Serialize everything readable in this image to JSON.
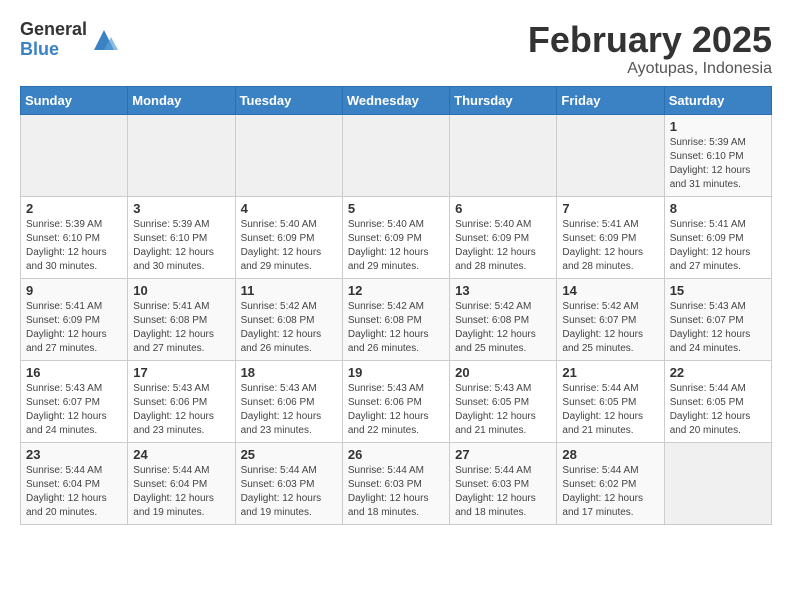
{
  "header": {
    "logo_general": "General",
    "logo_blue": "Blue",
    "month": "February 2025",
    "location": "Ayotupas, Indonesia"
  },
  "calendar": {
    "days_of_week": [
      "Sunday",
      "Monday",
      "Tuesday",
      "Wednesday",
      "Thursday",
      "Friday",
      "Saturday"
    ],
    "weeks": [
      [
        {
          "day": "",
          "info": ""
        },
        {
          "day": "",
          "info": ""
        },
        {
          "day": "",
          "info": ""
        },
        {
          "day": "",
          "info": ""
        },
        {
          "day": "",
          "info": ""
        },
        {
          "day": "",
          "info": ""
        },
        {
          "day": "1",
          "info": "Sunrise: 5:39 AM\nSunset: 6:10 PM\nDaylight: 12 hours\nand 31 minutes."
        }
      ],
      [
        {
          "day": "2",
          "info": "Sunrise: 5:39 AM\nSunset: 6:10 PM\nDaylight: 12 hours\nand 30 minutes."
        },
        {
          "day": "3",
          "info": "Sunrise: 5:39 AM\nSunset: 6:10 PM\nDaylight: 12 hours\nand 30 minutes."
        },
        {
          "day": "4",
          "info": "Sunrise: 5:40 AM\nSunset: 6:09 PM\nDaylight: 12 hours\nand 29 minutes."
        },
        {
          "day": "5",
          "info": "Sunrise: 5:40 AM\nSunset: 6:09 PM\nDaylight: 12 hours\nand 29 minutes."
        },
        {
          "day": "6",
          "info": "Sunrise: 5:40 AM\nSunset: 6:09 PM\nDaylight: 12 hours\nand 28 minutes."
        },
        {
          "day": "7",
          "info": "Sunrise: 5:41 AM\nSunset: 6:09 PM\nDaylight: 12 hours\nand 28 minutes."
        },
        {
          "day": "8",
          "info": "Sunrise: 5:41 AM\nSunset: 6:09 PM\nDaylight: 12 hours\nand 27 minutes."
        }
      ],
      [
        {
          "day": "9",
          "info": "Sunrise: 5:41 AM\nSunset: 6:09 PM\nDaylight: 12 hours\nand 27 minutes."
        },
        {
          "day": "10",
          "info": "Sunrise: 5:41 AM\nSunset: 6:08 PM\nDaylight: 12 hours\nand 27 minutes."
        },
        {
          "day": "11",
          "info": "Sunrise: 5:42 AM\nSunset: 6:08 PM\nDaylight: 12 hours\nand 26 minutes."
        },
        {
          "day": "12",
          "info": "Sunrise: 5:42 AM\nSunset: 6:08 PM\nDaylight: 12 hours\nand 26 minutes."
        },
        {
          "day": "13",
          "info": "Sunrise: 5:42 AM\nSunset: 6:08 PM\nDaylight: 12 hours\nand 25 minutes."
        },
        {
          "day": "14",
          "info": "Sunrise: 5:42 AM\nSunset: 6:07 PM\nDaylight: 12 hours\nand 25 minutes."
        },
        {
          "day": "15",
          "info": "Sunrise: 5:43 AM\nSunset: 6:07 PM\nDaylight: 12 hours\nand 24 minutes."
        }
      ],
      [
        {
          "day": "16",
          "info": "Sunrise: 5:43 AM\nSunset: 6:07 PM\nDaylight: 12 hours\nand 24 minutes."
        },
        {
          "day": "17",
          "info": "Sunrise: 5:43 AM\nSunset: 6:06 PM\nDaylight: 12 hours\nand 23 minutes."
        },
        {
          "day": "18",
          "info": "Sunrise: 5:43 AM\nSunset: 6:06 PM\nDaylight: 12 hours\nand 23 minutes."
        },
        {
          "day": "19",
          "info": "Sunrise: 5:43 AM\nSunset: 6:06 PM\nDaylight: 12 hours\nand 22 minutes."
        },
        {
          "day": "20",
          "info": "Sunrise: 5:43 AM\nSunset: 6:05 PM\nDaylight: 12 hours\nand 21 minutes."
        },
        {
          "day": "21",
          "info": "Sunrise: 5:44 AM\nSunset: 6:05 PM\nDaylight: 12 hours\nand 21 minutes."
        },
        {
          "day": "22",
          "info": "Sunrise: 5:44 AM\nSunset: 6:05 PM\nDaylight: 12 hours\nand 20 minutes."
        }
      ],
      [
        {
          "day": "23",
          "info": "Sunrise: 5:44 AM\nSunset: 6:04 PM\nDaylight: 12 hours\nand 20 minutes."
        },
        {
          "day": "24",
          "info": "Sunrise: 5:44 AM\nSunset: 6:04 PM\nDaylight: 12 hours\nand 19 minutes."
        },
        {
          "day": "25",
          "info": "Sunrise: 5:44 AM\nSunset: 6:03 PM\nDaylight: 12 hours\nand 19 minutes."
        },
        {
          "day": "26",
          "info": "Sunrise: 5:44 AM\nSunset: 6:03 PM\nDaylight: 12 hours\nand 18 minutes."
        },
        {
          "day": "27",
          "info": "Sunrise: 5:44 AM\nSunset: 6:03 PM\nDaylight: 12 hours\nand 18 minutes."
        },
        {
          "day": "28",
          "info": "Sunrise: 5:44 AM\nSunset: 6:02 PM\nDaylight: 12 hours\nand 17 minutes."
        },
        {
          "day": "",
          "info": ""
        }
      ]
    ]
  }
}
